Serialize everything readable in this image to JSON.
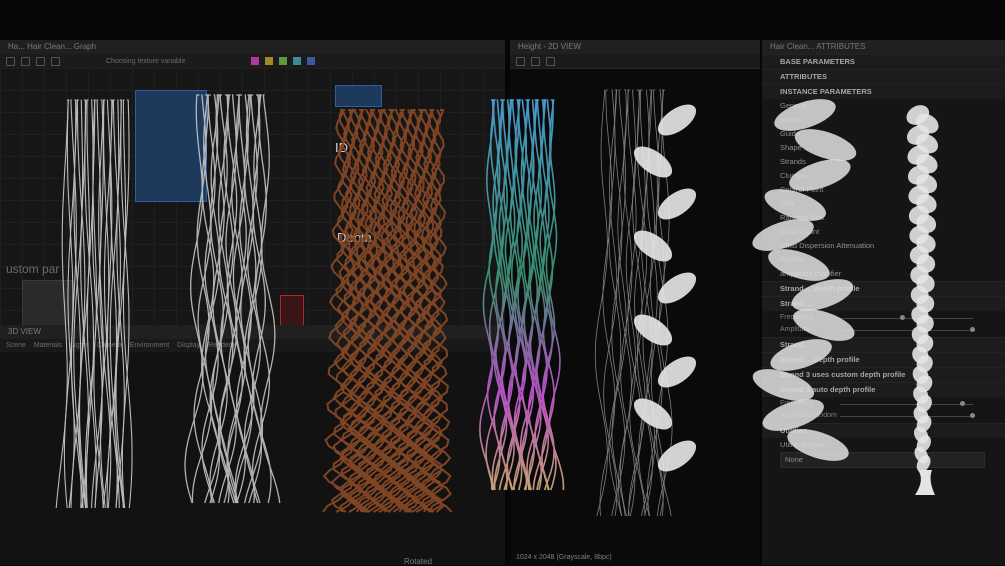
{
  "graph_panel": {
    "title": "Ha... Hair Clean... Graph",
    "toolbar_text": "Choosing texture variable",
    "node_labels": [
      "ID",
      "Depth"
    ],
    "side_text": "ustom par"
  },
  "view3d_panel": {
    "title": "3D VIEW",
    "menu": [
      "Scene",
      "Materials",
      "Lights",
      "Camera",
      "Environment",
      "Display",
      "Renderer"
    ]
  },
  "view2d_panel": {
    "title": "Height - 2D VIEW",
    "footer": "1024 x 2048 (Grayscale, 8bpc)"
  },
  "attrs_panel": {
    "title": "Hair Clean... ATTRIBUTES",
    "sections": [
      "BASE PARAMETERS",
      "ATTRIBUTES",
      "INSTANCE PARAMETERS"
    ],
    "items": [
      "General",
      "Inputs",
      "Guide",
      "Shape",
      "Strands",
      "Clumps",
      "Control Point",
      "Drift",
      "Random Drift",
      "Child Count",
      "Child Dispersion Attenuation",
      "Profiles",
      "amplitude modifier"
    ],
    "strand_rows": [
      {
        "label": "Strand ... depth profile"
      },
      {
        "label": "Strand ..."
      },
      {
        "label": "Strand ..."
      },
      {
        "label": "Strand ... depth profile"
      },
      {
        "label": "Strand 3 uses custom depth profile"
      },
      {
        "label": "Strand 3 auto depth profile"
      }
    ],
    "slider_labels": [
      "Frequency",
      "Amplitude",
      "Frequency",
      "Amplitude random"
    ],
    "utilities": "Utilities",
    "utility_display": "Utility display",
    "utility_value": "None"
  },
  "bottom_label": "Rotated",
  "colors": {
    "accent_blue": "#2d5fa0",
    "hair_white": "#d8d8d8",
    "hair_brown": "#8a4a26",
    "hair_cyan": "#4fa8e0",
    "hair_green": "#3f9b7a",
    "hair_pink": "#c85ad8"
  }
}
